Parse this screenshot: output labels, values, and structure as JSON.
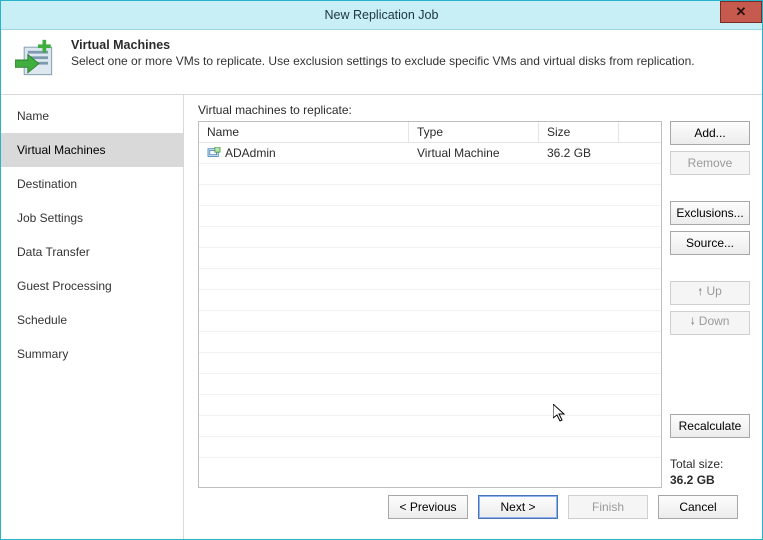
{
  "window": {
    "title": "New Replication Job",
    "close_glyph": "✕"
  },
  "header": {
    "title": "Virtual Machines",
    "subtitle": "Select one or more VMs to replicate. Use exclusion settings to exclude specific VMs and virtual disks from replication."
  },
  "steps": [
    {
      "label": "Name",
      "active": false
    },
    {
      "label": "Virtual Machines",
      "active": true
    },
    {
      "label": "Destination",
      "active": false
    },
    {
      "label": "Job Settings",
      "active": false
    },
    {
      "label": "Data Transfer",
      "active": false
    },
    {
      "label": "Guest Processing",
      "active": false
    },
    {
      "label": "Schedule",
      "active": false
    },
    {
      "label": "Summary",
      "active": false
    }
  ],
  "main": {
    "list_label": "Virtual machines to replicate:",
    "columns": {
      "name": "Name",
      "type": "Type",
      "size": "Size"
    },
    "rows": [
      {
        "name": "ADAdmin",
        "type": "Virtual Machine",
        "size": "36.2 GB"
      }
    ],
    "buttons": {
      "add": "Add...",
      "remove": "Remove",
      "exclusions": "Exclusions...",
      "source": "Source...",
      "up": "Up",
      "down": "Down",
      "recalculate": "Recalculate"
    },
    "up_arrow": "🠕",
    "down_arrow": "🠗",
    "total_label": "Total size:",
    "total_value": "36.2 GB"
  },
  "footer": {
    "previous": "< Previous",
    "next": "Next >",
    "finish": "Finish",
    "cancel": "Cancel"
  }
}
